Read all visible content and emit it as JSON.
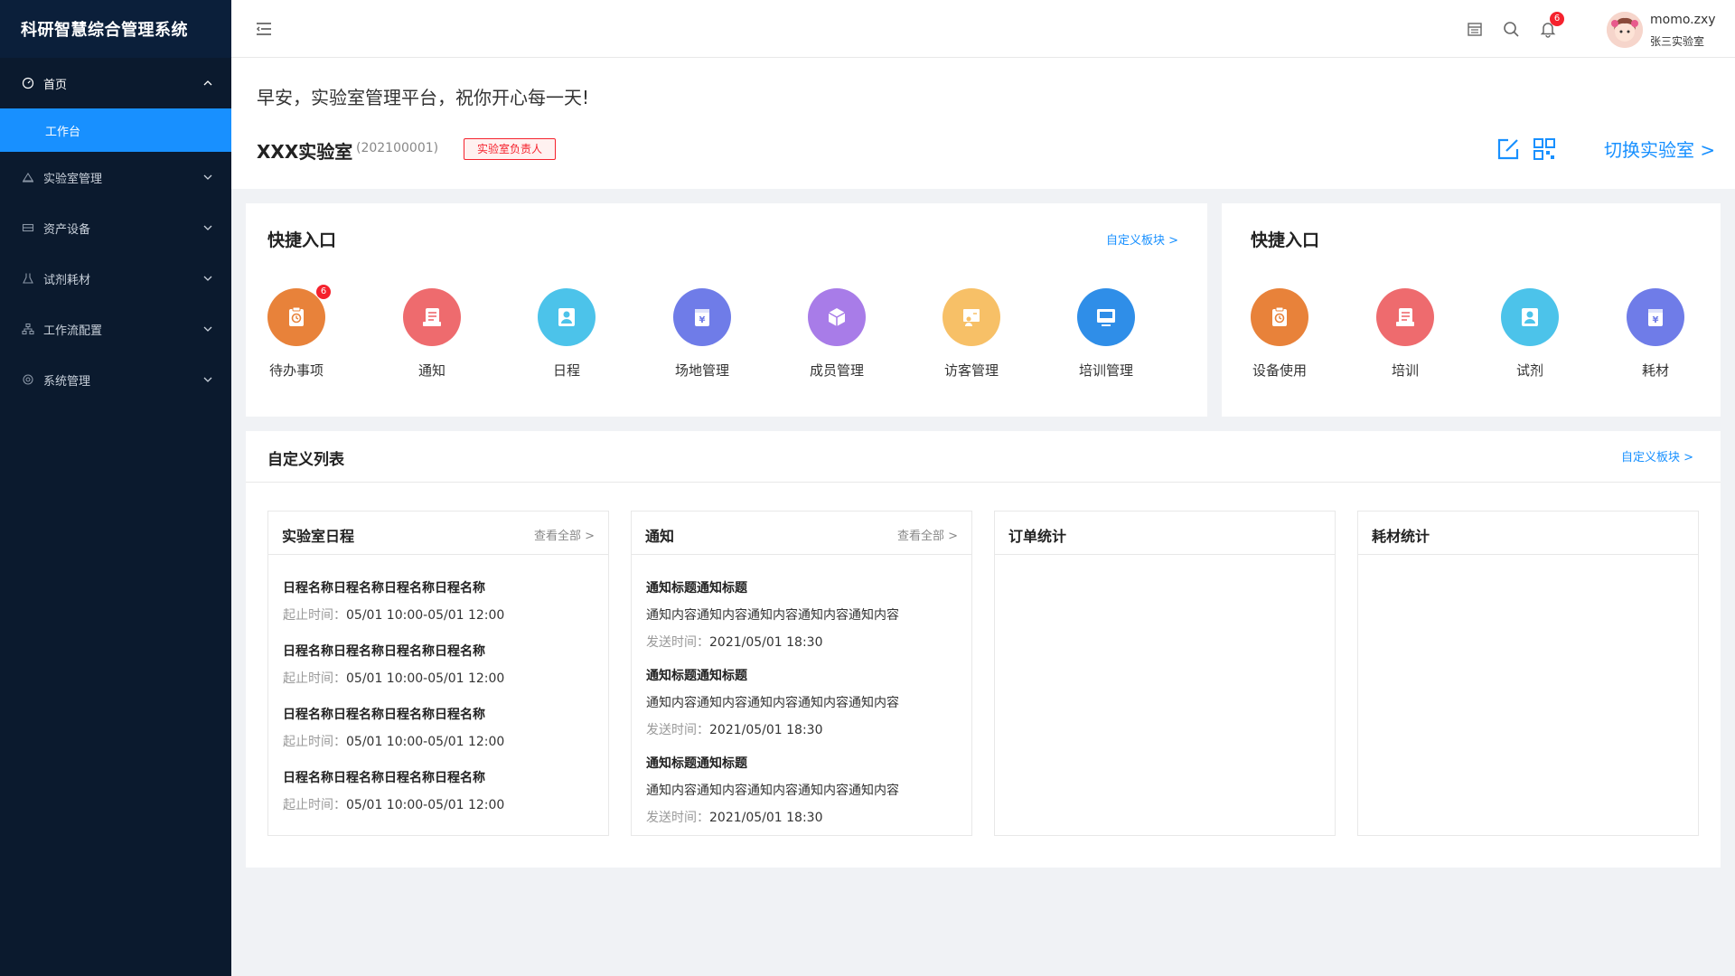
{
  "app": {
    "title": "科研智慧综合管理系统"
  },
  "sidebar": {
    "items": [
      {
        "label": "首页",
        "icon": "dashboard-icon",
        "open": true
      },
      {
        "label": "实验室管理",
        "icon": "lab-icon"
      },
      {
        "label": "资产设备",
        "icon": "device-icon"
      },
      {
        "label": "试剂耗材",
        "icon": "flask-icon"
      },
      {
        "label": "工作流配置",
        "icon": "workflow-icon"
      },
      {
        "label": "系统管理",
        "icon": "settings-icon"
      }
    ],
    "sub_active": "工作台"
  },
  "header": {
    "notifications_count": "6",
    "user": {
      "name": "momo.zxy",
      "lab": "张三实验室"
    }
  },
  "welcome": {
    "greeting": "早安，实验室管理平台，祝你开心每一天!",
    "lab_name": "XXX实验室",
    "lab_code": "(202100001)",
    "role": "实验室负责人",
    "switch_label": "切换实验室 >"
  },
  "quick_left": {
    "title": "快捷入口",
    "link": "自定义板块  >",
    "items": [
      {
        "label": "待办事项",
        "color": "#e8823a",
        "icon": "clipboard-clock-icon",
        "badge": "6"
      },
      {
        "label": "通知",
        "color": "#ee6b6e",
        "icon": "notice-list-icon"
      },
      {
        "label": "日程",
        "color": "#4cc3ea",
        "icon": "id-card-icon"
      },
      {
        "label": "场地管理",
        "color": "#6f7ce8",
        "icon": "yuan-doc-icon"
      },
      {
        "label": "成员管理",
        "color": "#a87ce8",
        "icon": "cube-icon"
      },
      {
        "label": "访客管理",
        "color": "#f7c067",
        "icon": "presentation-icon"
      },
      {
        "label": "培训管理",
        "color": "#2f8ee8",
        "icon": "monitor-icon"
      }
    ]
  },
  "quick_right": {
    "title": "快捷入口",
    "items": [
      {
        "label": "设备使用",
        "color": "#e8823a",
        "icon": "clipboard-clock-icon"
      },
      {
        "label": "培训",
        "color": "#ee6b6e",
        "icon": "notice-list-icon"
      },
      {
        "label": "试剂",
        "color": "#4cc3ea",
        "icon": "id-card-icon"
      },
      {
        "label": "耗材",
        "color": "#6f7ce8",
        "icon": "yuan-doc-icon"
      }
    ]
  },
  "custom_list": {
    "title": "自定义列表",
    "link": "自定义板块  >",
    "schedule": {
      "title": "实验室日程",
      "view_all": "查看全部 >",
      "time_label": "起止时间：",
      "entries": [
        {
          "name": "日程名称日程名称日程名称日程名称",
          "time": "05/01 10:00-05/01 12:00"
        },
        {
          "name": "日程名称日程名称日程名称日程名称",
          "time": "05/01 10:00-05/01 12:00"
        },
        {
          "name": "日程名称日程名称日程名称日程名称",
          "time": "05/01 10:00-05/01 12:00"
        },
        {
          "name": "日程名称日程名称日程名称日程名称",
          "time": "05/01 10:00-05/01 12:00"
        }
      ]
    },
    "notice": {
      "title": "通知",
      "view_all": "查看全部 >",
      "time_label": "发送时间：",
      "entries": [
        {
          "title": "通知标题通知标题",
          "content": "通知内容通知内容通知内容通知内容通知内容",
          "time": "2021/05/01 18:30"
        },
        {
          "title": "通知标题通知标题",
          "content": "通知内容通知内容通知内容通知内容通知内容",
          "time": "2021/05/01 18:30"
        },
        {
          "title": "通知标题通知标题",
          "content": "通知内容通知内容通知内容通知内容通知内容",
          "time": "2021/05/01 18:30"
        }
      ]
    },
    "orders": {
      "title": "订单统计"
    },
    "consumables": {
      "title": "耗材统计"
    }
  },
  "colors": {
    "primary": "#1890ff",
    "sidebar_bg": "#0b1a2e",
    "badge": "#f5222d"
  }
}
